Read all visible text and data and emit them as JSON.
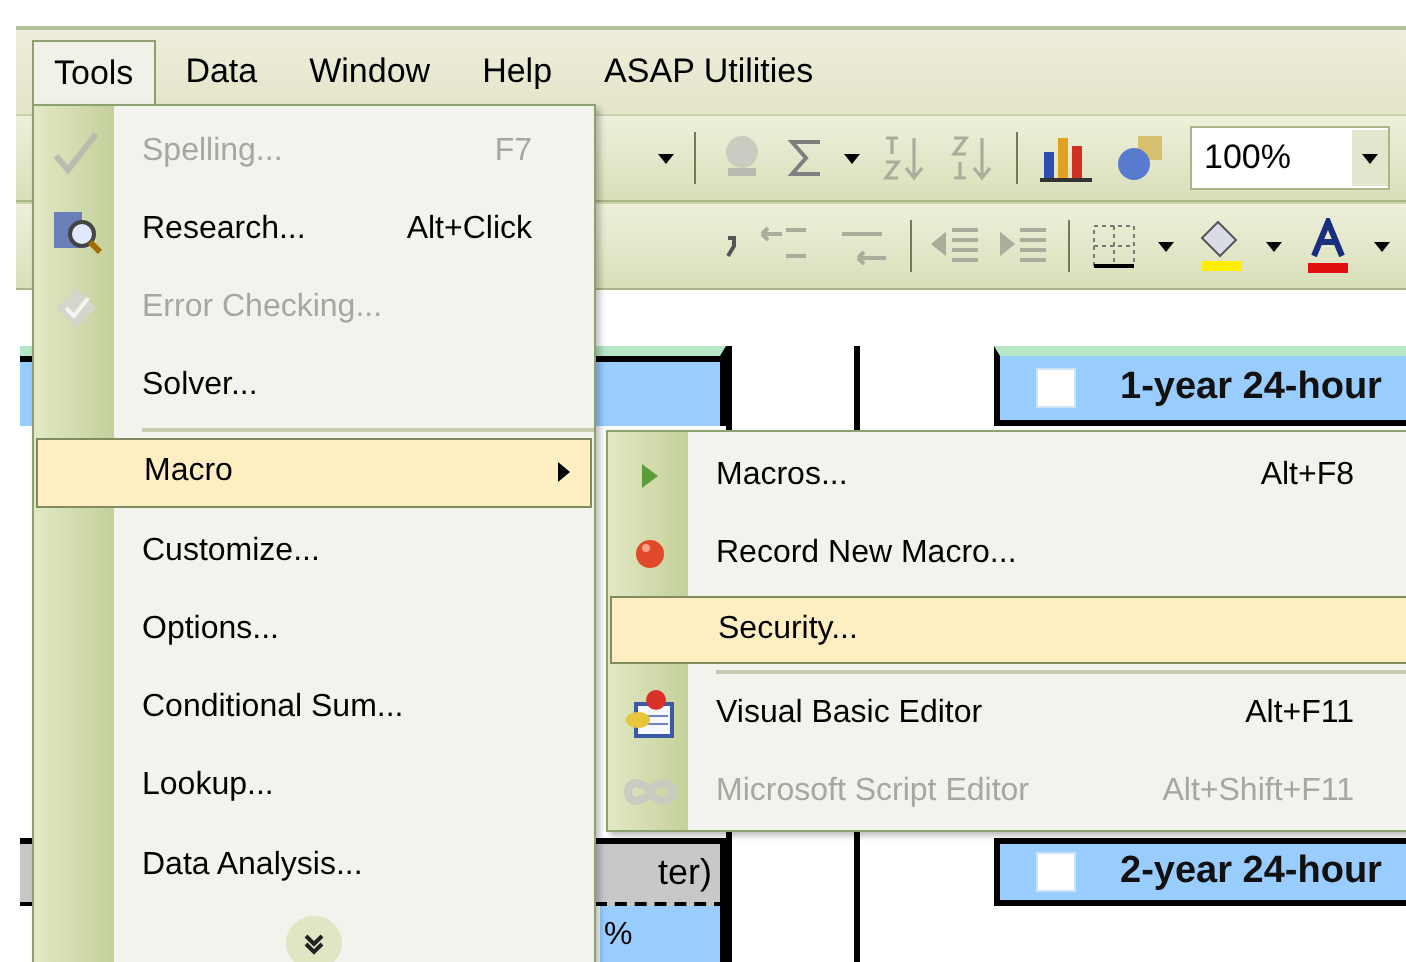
{
  "menu_bar": {
    "items": [
      {
        "label": "Tools",
        "selected": true
      },
      {
        "label": "Data",
        "selected": false
      },
      {
        "label": "Window",
        "selected": false
      },
      {
        "label": "Help",
        "selected": false
      },
      {
        "label": "ASAP Utilities",
        "selected": false
      }
    ]
  },
  "standard_toolbar": {
    "zoom": "100%"
  },
  "sheet": {
    "header_cells": [
      {
        "text": "1-year 24-hour",
        "checked": false
      },
      {
        "text": "2-year 24-hour",
        "checked": false
      }
    ],
    "column_cells": [
      {
        "text": "ter)"
      },
      {
        "text": "%"
      }
    ]
  },
  "tools_menu": {
    "items": [
      {
        "kind": "item",
        "label": "Spelling...",
        "shortcut": "F7",
        "disabled": true,
        "selected": false,
        "submenu": false
      },
      {
        "kind": "item",
        "label": "Research...",
        "shortcut": "Alt+Click",
        "disabled": false,
        "selected": false,
        "submenu": false
      },
      {
        "kind": "item",
        "label": "Error Checking...",
        "disabled": true,
        "selected": false,
        "submenu": false
      },
      {
        "kind": "item",
        "label": "Solver...",
        "disabled": false,
        "selected": false,
        "submenu": false
      },
      {
        "kind": "separator"
      },
      {
        "kind": "item",
        "label": "Macro",
        "disabled": false,
        "selected": true,
        "submenu": true
      },
      {
        "kind": "item",
        "label": "Customize...",
        "disabled": false,
        "selected": false,
        "submenu": false
      },
      {
        "kind": "item",
        "label": "Options...",
        "disabled": false,
        "selected": false,
        "submenu": false
      },
      {
        "kind": "item",
        "label": "Conditional Sum...",
        "disabled": false,
        "selected": false,
        "submenu": false
      },
      {
        "kind": "item",
        "label": "Lookup...",
        "disabled": false,
        "selected": false,
        "submenu": false
      },
      {
        "kind": "item",
        "label": "Data Analysis...",
        "disabled": false,
        "selected": false,
        "submenu": false
      }
    ]
  },
  "macro_submenu": {
    "items": [
      {
        "kind": "item",
        "label": "Macros...",
        "shortcut": "Alt+F8",
        "disabled": false,
        "selected": false
      },
      {
        "kind": "item",
        "label": "Record New Macro...",
        "disabled": false,
        "selected": false
      },
      {
        "kind": "item",
        "label": "Security...",
        "disabled": false,
        "selected": true
      },
      {
        "kind": "separator"
      },
      {
        "kind": "item",
        "label": "Visual Basic Editor",
        "shortcut": "Alt+F11",
        "disabled": false,
        "selected": false
      },
      {
        "kind": "item",
        "label": "Microsoft Script Editor",
        "shortcut": "Alt+Shift+F11",
        "disabled": true,
        "selected": false
      }
    ]
  }
}
